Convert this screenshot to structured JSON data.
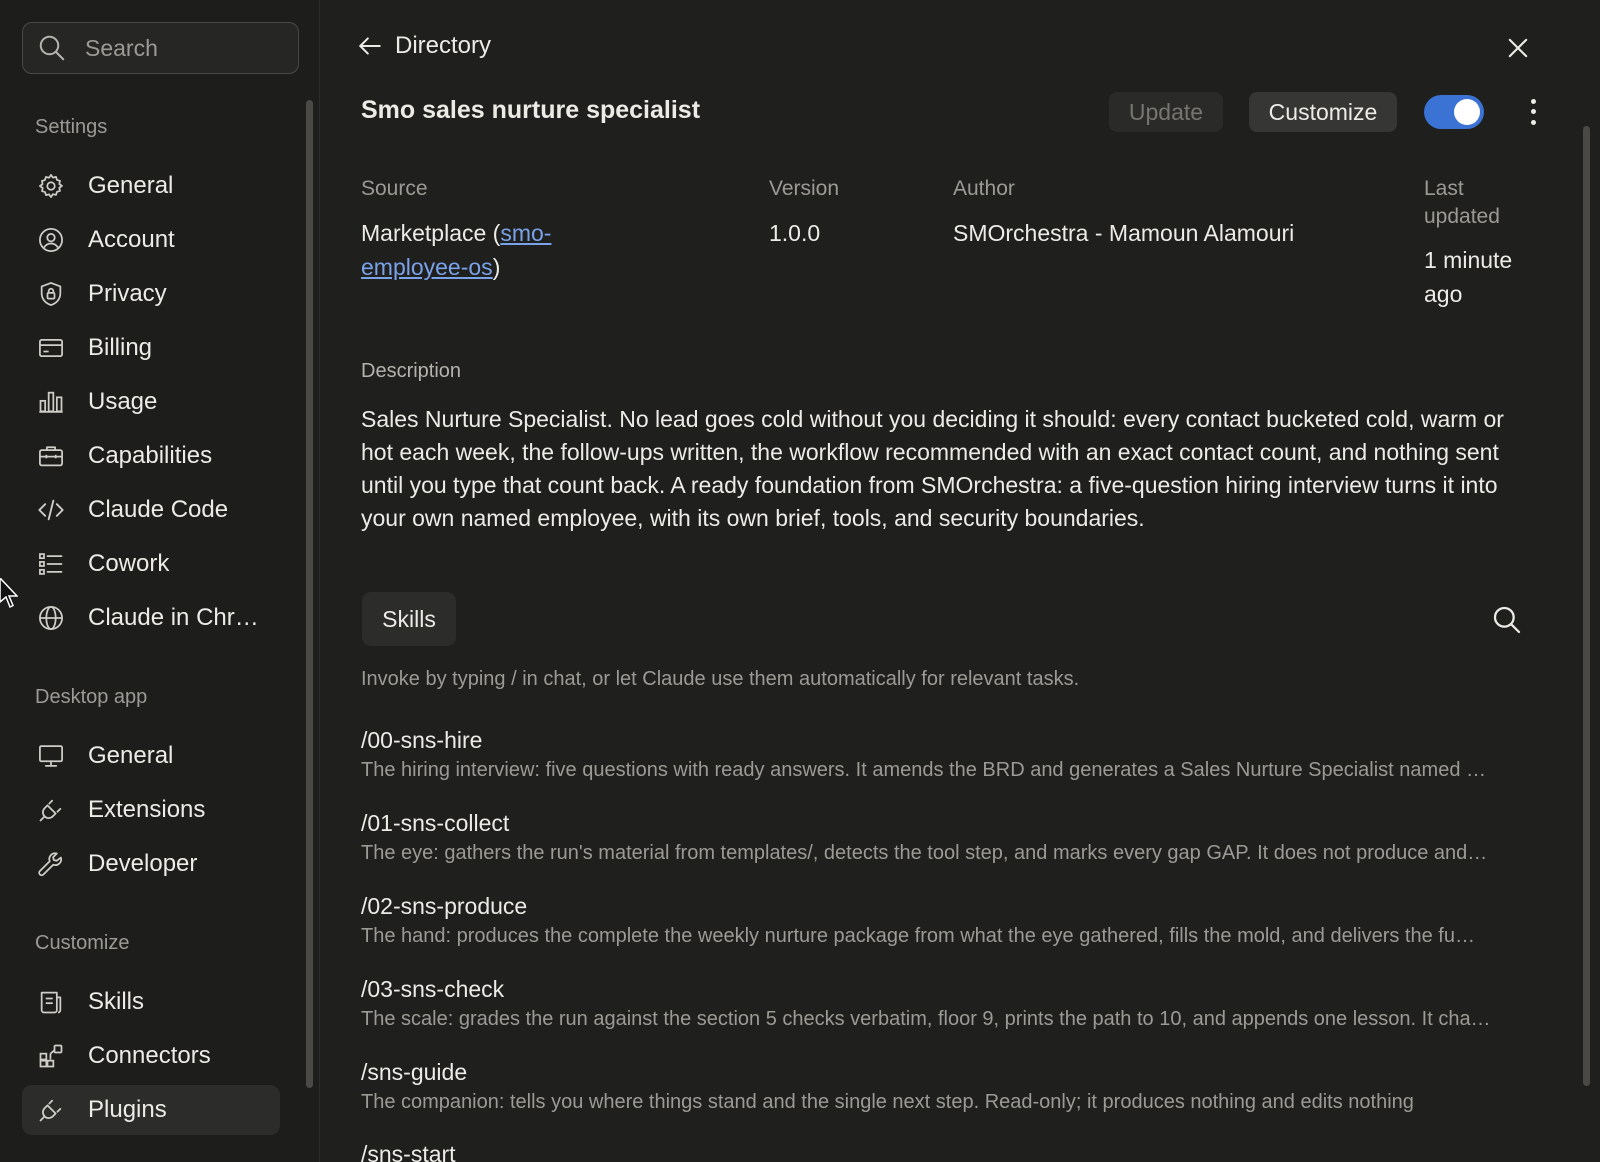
{
  "search": {
    "placeholder": "Search"
  },
  "sidebar": {
    "settings_label": "Settings",
    "settings_items": [
      {
        "label": "General",
        "icon": "gear-icon"
      },
      {
        "label": "Account",
        "icon": "user-circle-icon"
      },
      {
        "label": "Privacy",
        "icon": "shield-lock-icon"
      },
      {
        "label": "Billing",
        "icon": "credit-card-icon"
      },
      {
        "label": "Usage",
        "icon": "bar-chart-icon"
      },
      {
        "label": "Capabilities",
        "icon": "toolbox-icon"
      },
      {
        "label": "Claude Code",
        "icon": "code-icon"
      },
      {
        "label": "Cowork",
        "icon": "checklist-icon"
      },
      {
        "label": "Claude in Chr…",
        "icon": "globe-icon"
      }
    ],
    "desktop_label": "Desktop app",
    "desktop_items": [
      {
        "label": "General",
        "icon": "monitor-icon"
      },
      {
        "label": "Extensions",
        "icon": "plug-icon"
      },
      {
        "label": "Developer",
        "icon": "wrench-icon"
      }
    ],
    "customize_label": "Customize",
    "customize_items": [
      {
        "label": "Skills",
        "icon": "skills-icon"
      },
      {
        "label": "Connectors",
        "icon": "connectors-icon"
      },
      {
        "label": "Plugins",
        "icon": "plug-icon",
        "active": true
      }
    ]
  },
  "header": {
    "back_label": "Directory",
    "title": "Smo sales nurture specialist",
    "update_label": "Update",
    "customize_label": "Customize",
    "enabled": true
  },
  "meta": {
    "source_label": "Source",
    "source_prefix": "Marketplace (",
    "source_link_1": "smo-",
    "source_link_2": "employee-os",
    "source_suffix": ")",
    "version_label": "Version",
    "version": "1.0.0",
    "author_label": "Author",
    "author": "SMOrchestra - Mamoun Alamouri",
    "updated_label_1": "Last",
    "updated_label_2": "updated",
    "updated_value_1": "1 minute",
    "updated_value_2": "ago"
  },
  "description": {
    "label": "Description",
    "text": "Sales Nurture Specialist. No lead goes cold without you deciding it should: every contact bucketed cold, warm or hot each week, the follow-ups written, the workflow recommended with an exact contact count, and nothing sent until you type that count back. A ready foundation from SMOrchestra: a five-question hiring interview turns it into your own named employee, with its own brief, tools, and security boundaries."
  },
  "skills": {
    "tab_label": "Skills",
    "hint": "Invoke by typing / in chat, or let Claude use them automatically for relevant tasks.",
    "items": [
      {
        "name": "/00-sns-hire",
        "desc": "The hiring interview: five questions with ready answers. It amends the BRD and generates a Sales Nurture Specialist named …"
      },
      {
        "name": "/01-sns-collect",
        "desc": "The eye: gathers the run's material from templates/, detects the tool step, and marks every gap GAP. It does not produce and…"
      },
      {
        "name": "/02-sns-produce",
        "desc": "The hand: produces the complete the weekly nurture package from what the eye gathered, fills the mold, and delivers the fu…"
      },
      {
        "name": "/03-sns-check",
        "desc": "The scale: grades the run against the section 5 checks verbatim, floor 9, prints the path to 10, and appends one lesson. It cha…"
      },
      {
        "name": "/sns-guide",
        "desc": "The companion: tells you where things stand and the single next step. Read-only; it produces nothing and edits nothing"
      },
      {
        "name": "/sns-start",
        "desc": ""
      }
    ]
  }
}
